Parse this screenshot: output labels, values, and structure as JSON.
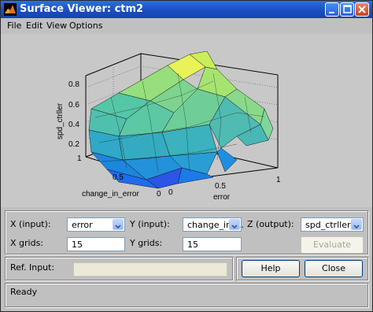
{
  "window": {
    "title": "Surface Viewer: ctm2"
  },
  "menu": [
    "File",
    "Edit",
    "View",
    "Options"
  ],
  "plot": {
    "z_label": "spd_ctrller",
    "x_label": "error",
    "y_label": "change_in_error",
    "z_ticks": [
      "0.8",
      "0.6",
      "0.4",
      "0.2"
    ],
    "y_ticks": [
      "1",
      "0.5",
      "0"
    ],
    "x_ticks": [
      "0",
      "0.5",
      "1"
    ]
  },
  "controls": {
    "x_input_label": "X (input):",
    "x_input_value": "error",
    "y_input_label": "Y (input):",
    "y_input_value": "change_in_...",
    "z_output_label": "Z (output):",
    "z_output_value": "spd_ctrller",
    "x_grids_label": "X grids:",
    "x_grids_value": "15",
    "y_grids_label": "Y grids:",
    "y_grids_value": "15",
    "evaluate_label": "Evaluate",
    "ref_input_label": "Ref. Input:",
    "help_label": "Help",
    "close_label": "Close",
    "status": "Ready"
  }
}
